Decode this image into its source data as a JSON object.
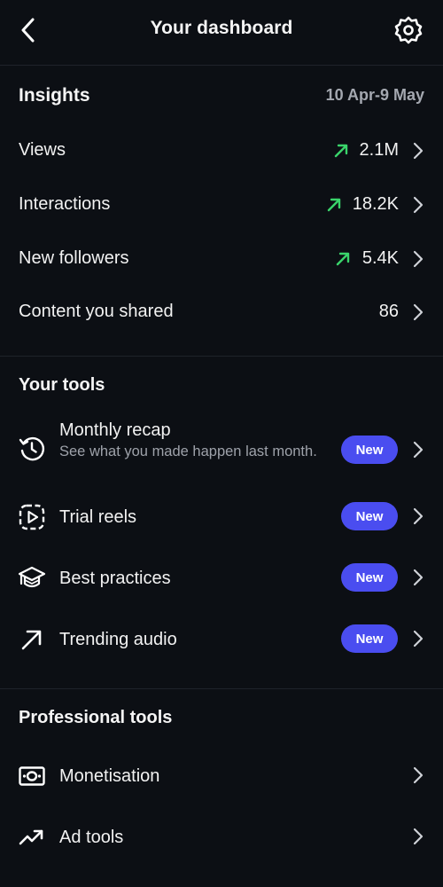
{
  "header": {
    "title": "Your dashboard",
    "back_icon": "chevron-left-icon",
    "settings_icon": "gear-icon"
  },
  "insights": {
    "heading": "Insights",
    "date_range": "10 Apr-9 May",
    "trend_color": "#3ad46b",
    "rows": [
      {
        "label": "Views",
        "value": "2.1M",
        "trend": "up"
      },
      {
        "label": "Interactions",
        "value": "18.2K",
        "trend": "up"
      },
      {
        "label": "New followers",
        "value": "5.4K",
        "trend": "up"
      },
      {
        "label": "Content you shared",
        "value": "86",
        "trend": ""
      }
    ]
  },
  "your_tools": {
    "heading": "Your tools",
    "items": [
      {
        "title": "Monthly recap",
        "subtitle": "See what you made happen last month.",
        "badge": "New",
        "icon": "history-clock-icon"
      },
      {
        "title": "Trial reels",
        "badge": "New",
        "icon": "reels-play-icon"
      },
      {
        "title": "Best practices",
        "badge": "New",
        "icon": "graduation-cap-icon"
      },
      {
        "title": "Trending audio",
        "badge": "New",
        "icon": "arrow-up-right-icon"
      }
    ]
  },
  "professional_tools": {
    "heading": "Professional tools",
    "items": [
      {
        "title": "Monetisation",
        "icon": "banknote-icon"
      },
      {
        "title": "Ad tools",
        "icon": "trend-up-icon"
      }
    ]
  },
  "colors": {
    "background": "#0c0f14",
    "badge": "#4a4df0",
    "accent_green": "#3ad46b",
    "muted_text": "#9ea2aa"
  }
}
